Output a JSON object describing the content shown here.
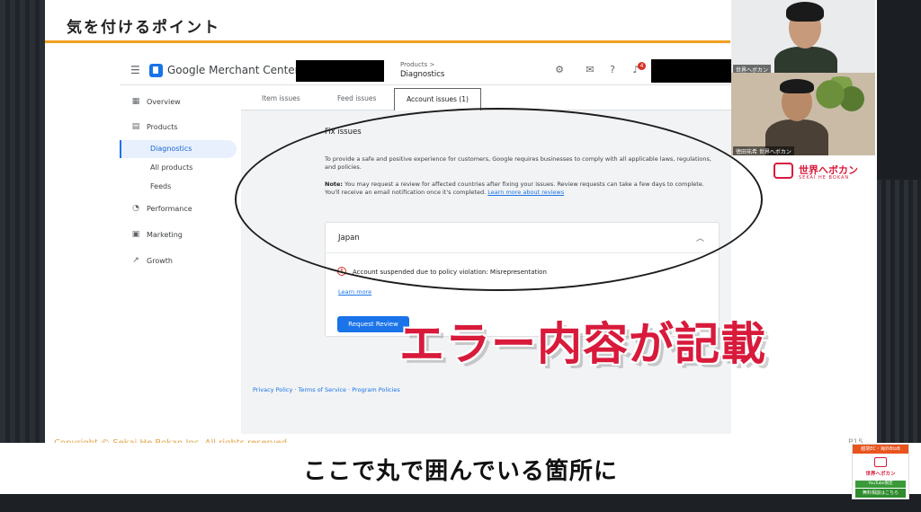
{
  "slide": {
    "title": "気を付けるポイント",
    "copyright": "Copyright © Sekai He Bokan Inc. All rights reserved.",
    "page_num": "P15"
  },
  "gmc": {
    "app_name": "Google Merchant Center",
    "breadcrumb_parent": "Products >",
    "breadcrumb_current": "Diagnostics",
    "notification_count": "4",
    "sidebar": {
      "items": [
        {
          "label": "Overview",
          "icon": "overview-icon"
        },
        {
          "label": "Products",
          "icon": "products-icon"
        },
        {
          "label": "Diagnostics",
          "active": true
        },
        {
          "label": "All products"
        },
        {
          "label": "Feeds"
        },
        {
          "label": "Performance",
          "icon": "performance-icon"
        },
        {
          "label": "Marketing",
          "icon": "marketing-icon"
        },
        {
          "label": "Growth",
          "icon": "growth-icon"
        }
      ]
    },
    "tabs": [
      {
        "label": "Item issues"
      },
      {
        "label": "Feed issues"
      },
      {
        "label": "Account issues (1)",
        "selected": true
      }
    ],
    "fix_title": "Fix issues",
    "fix_paragraph": "To provide a safe and positive experience for customers, Google requires businesses to comply with all applicable laws, regulations, and policies.",
    "note_label": "Note:",
    "note_text": "You may request a review for affected countries after fixing your issues. Review requests can take a few days to complete. You'll receive an email notification once it's completed.",
    "note_link": "Learn more about reviews",
    "card": {
      "country": "Japan",
      "error_text": "Account suspended due to policy violation: Misrepresentation",
      "learn_more": "Learn more",
      "button": "Request Review"
    },
    "footer_links": "Privacy Policy · Terms of Service · Program Policies"
  },
  "callout": "エラー内容が記載",
  "subtitle": "ここで丸で囲んでいる箇所に",
  "webcams": {
    "cam1_label": "世界へボカン",
    "cam2_label": "徳田祐希 世界へボカン"
  },
  "brand": {
    "name": "世界へボカン",
    "sub": "SEKAI HE BOKAN"
  },
  "ad": {
    "top": "越境EC・海外BtoB",
    "name": "世界へボカン",
    "btn1": "YouTube限定",
    "btn2": "無料相談はこちら"
  },
  "colors": {
    "accent_orange": "#f0a020",
    "callout_red": "#d81a3b",
    "google_blue": "#1a73e8"
  }
}
